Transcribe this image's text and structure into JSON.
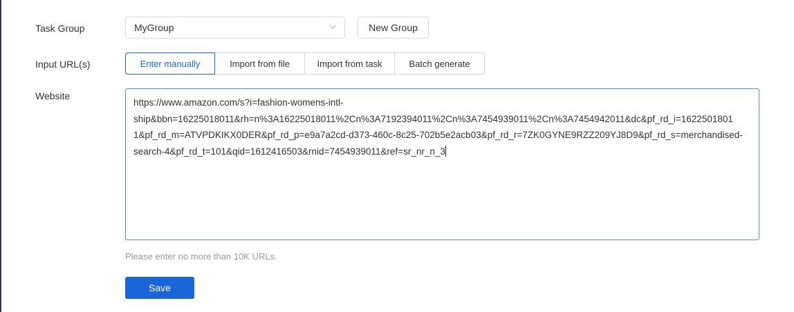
{
  "form": {
    "task_group_label": "Task Group",
    "task_group_value": "MyGroup",
    "new_group_label": "New Group",
    "input_urls_label": "Input URL(s)",
    "input_modes": [
      "Enter manually",
      "Import from file",
      "Import from task",
      "Batch generate"
    ],
    "active_mode": "Enter manually",
    "website_label": "Website",
    "website_value": "https://www.amazon.com/s?i=fashion-womens-intl-ship&bbn=16225018011&rh=n%3A16225018011%2Cn%3A7192394011%2Cn%3A7454939011%2Cn%3A7454942011&dc&pf_rd_i=16225018011&pf_rd_m=ATVPDKIKX0DER&pf_rd_p=e9a7a2cd-d373-460c-8c25-702b5e2acb03&pf_rd_r=7ZK0GYNE9RZZ209YJ8D9&pf_rd_s=merchandised-search-4&pf_rd_t=101&qid=1612416503&rnid=7454939011&ref=sr_nr_n_3",
    "website_lines": [
      "https://www.amazon.com/s?i=fashion-womens-intl-",
      "ship&bbn=16225018011&rh=n%3A16225018011%2Cn%3A7192394011%2Cn%3A7454939011%2Cn%3A7454942011&dc&pf_rd_i=1622501801",
      "1&pf_rd_m=ATVPDKIKX0DER&pf_rd_p=e9a7a2cd-d373-460c-8c25-702b5e2acb03&pf_rd_r=7ZK0GYNE9RZZ209YJ8D9&pf_rd_s=merchandised-",
      "search-4&pf_rd_t=101&qid=1612416503&rnid=7454939011&ref=sr_nr_n_3"
    ],
    "hint": "Please enter no more than 10K URLs.",
    "save_label": "Save"
  },
  "colors": {
    "accent": "#1a66d9",
    "focus_border": "#4a8ef0",
    "hint": "#999999"
  }
}
